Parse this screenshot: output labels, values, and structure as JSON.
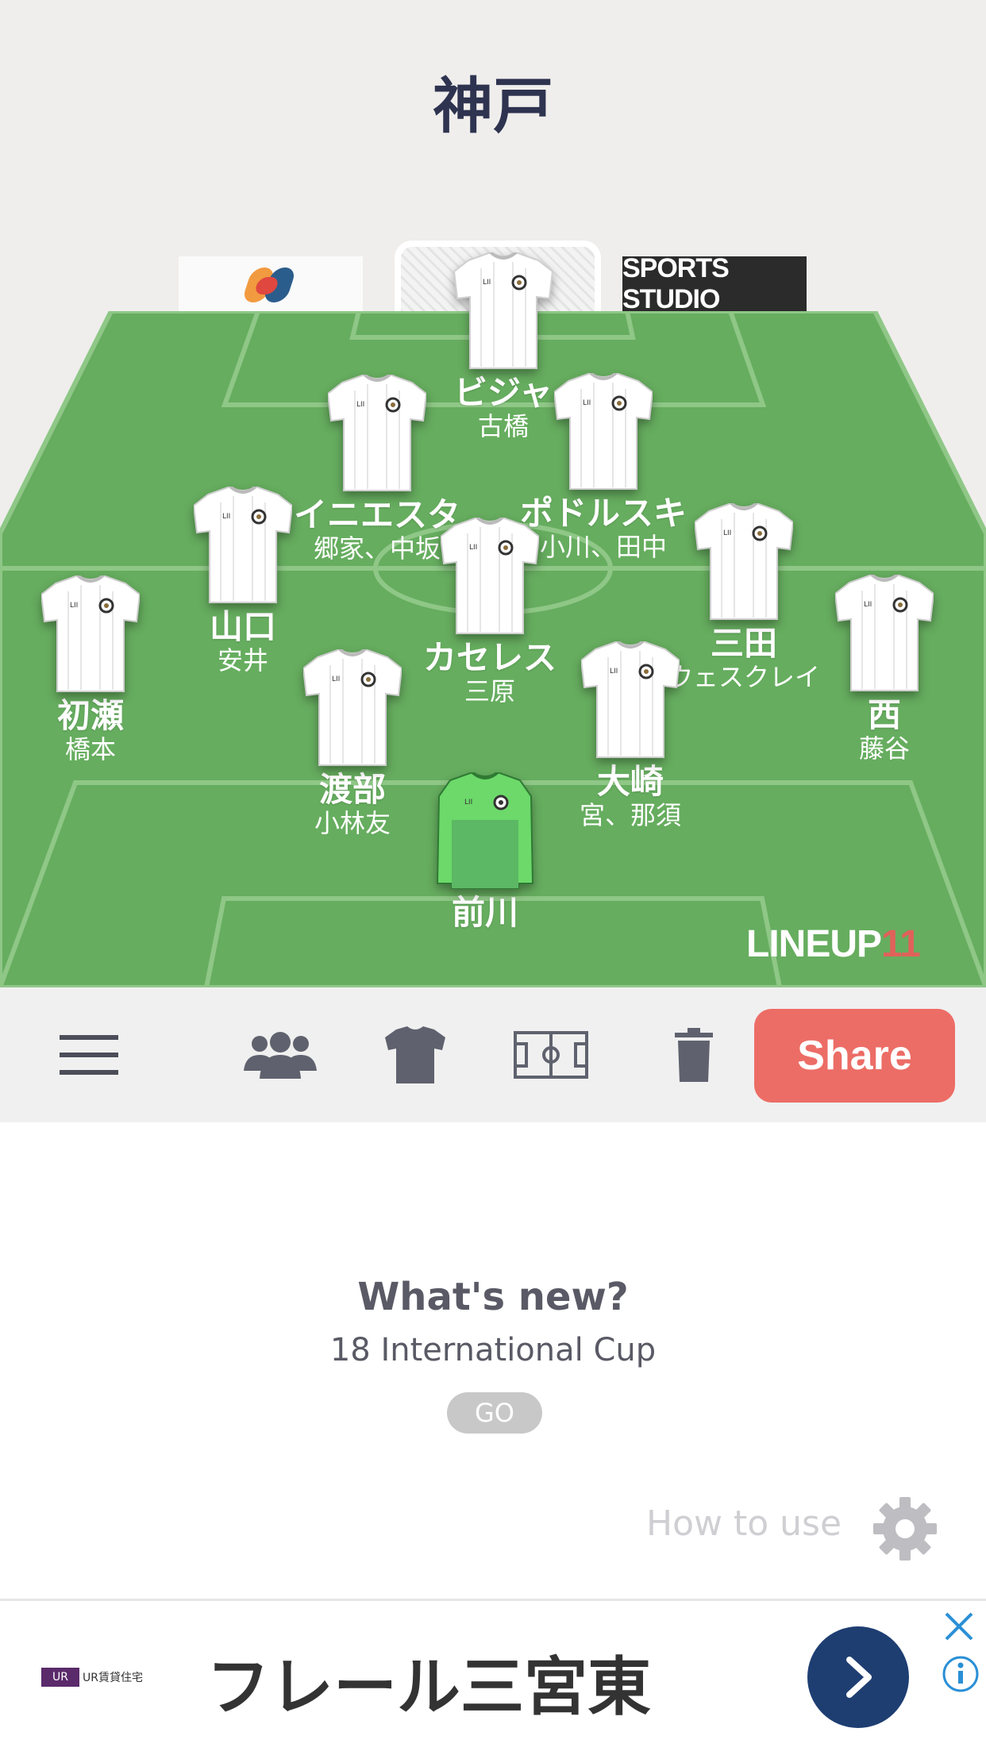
{
  "team_title": "神戸",
  "sponsors": {
    "left_board": "SS logo",
    "right_board": "SPORTS STUDIO"
  },
  "brand": {
    "text": "LINEUP",
    "number": "11"
  },
  "players": [
    {
      "name": "ビジャ",
      "sub": "古橋",
      "kit": "field"
    },
    {
      "name": "イニエスタ",
      "sub": "郷家、中坂",
      "kit": "field"
    },
    {
      "name": "ポドルスキ",
      "sub": "小川、田中",
      "kit": "field"
    },
    {
      "name": "山口",
      "sub": "安井",
      "kit": "field"
    },
    {
      "name": "カセレス",
      "sub": "三原",
      "kit": "field"
    },
    {
      "name": "三田",
      "sub": "ウェスクレイ",
      "kit": "field"
    },
    {
      "name": "初瀬",
      "sub": "橋本",
      "kit": "field"
    },
    {
      "name": "渡部",
      "sub": "小林友",
      "kit": "field"
    },
    {
      "name": "大崎",
      "sub": "宮、那須",
      "kit": "field"
    },
    {
      "name": "西",
      "sub": "藤谷",
      "kit": "field"
    },
    {
      "name": "前川",
      "sub": "",
      "kit": "goalkeeper"
    }
  ],
  "colors": {
    "pitch": "#66ad5f",
    "pitch_line": "#8fc787",
    "share": "#ec6d66",
    "gk_kit": "#6cd96a",
    "title": "#2e3350"
  },
  "toolbar": {
    "menu_icon": "hamburger-icon",
    "players_icon": "people-icon",
    "kit_icon": "shirt-icon",
    "field_icon": "field-icon",
    "delete_icon": "trash-icon",
    "share_label": "Share"
  },
  "whats_new": {
    "title": "What's new?",
    "subtitle": "18 International Cup",
    "button": "GO"
  },
  "how_to_use": "How to use",
  "ad": {
    "logo_text": "UR賃貸住宅",
    "logo_mark": "UR",
    "headline": "フレール三宮東"
  }
}
